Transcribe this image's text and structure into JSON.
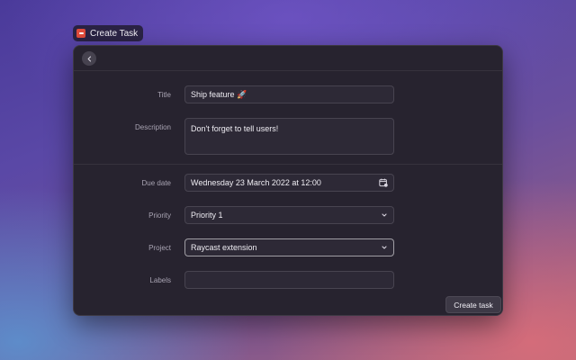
{
  "window": {
    "title": "Create Task"
  },
  "form": {
    "title": {
      "label": "Title",
      "value": "Ship feature 🚀"
    },
    "description": {
      "label": "Description",
      "value": "Don't forget to tell users!"
    },
    "due_date": {
      "label": "Due date",
      "value": "Wednesday 23 March 2022 at 12:00"
    },
    "priority": {
      "label": "Priority",
      "value": "Priority 1"
    },
    "project": {
      "label": "Project",
      "value": "Raycast extension"
    },
    "labels": {
      "label": "Labels",
      "value": ""
    }
  },
  "actions": {
    "submit_label": "Create task"
  },
  "icons": {
    "app": "todoist-app-icon",
    "back": "chevron-left-icon",
    "date_picker": "calendar-icon",
    "dropdown": "chevron-down-icon"
  },
  "colors": {
    "app_icon": "#e14b3b",
    "window_bg": "#27232f"
  }
}
